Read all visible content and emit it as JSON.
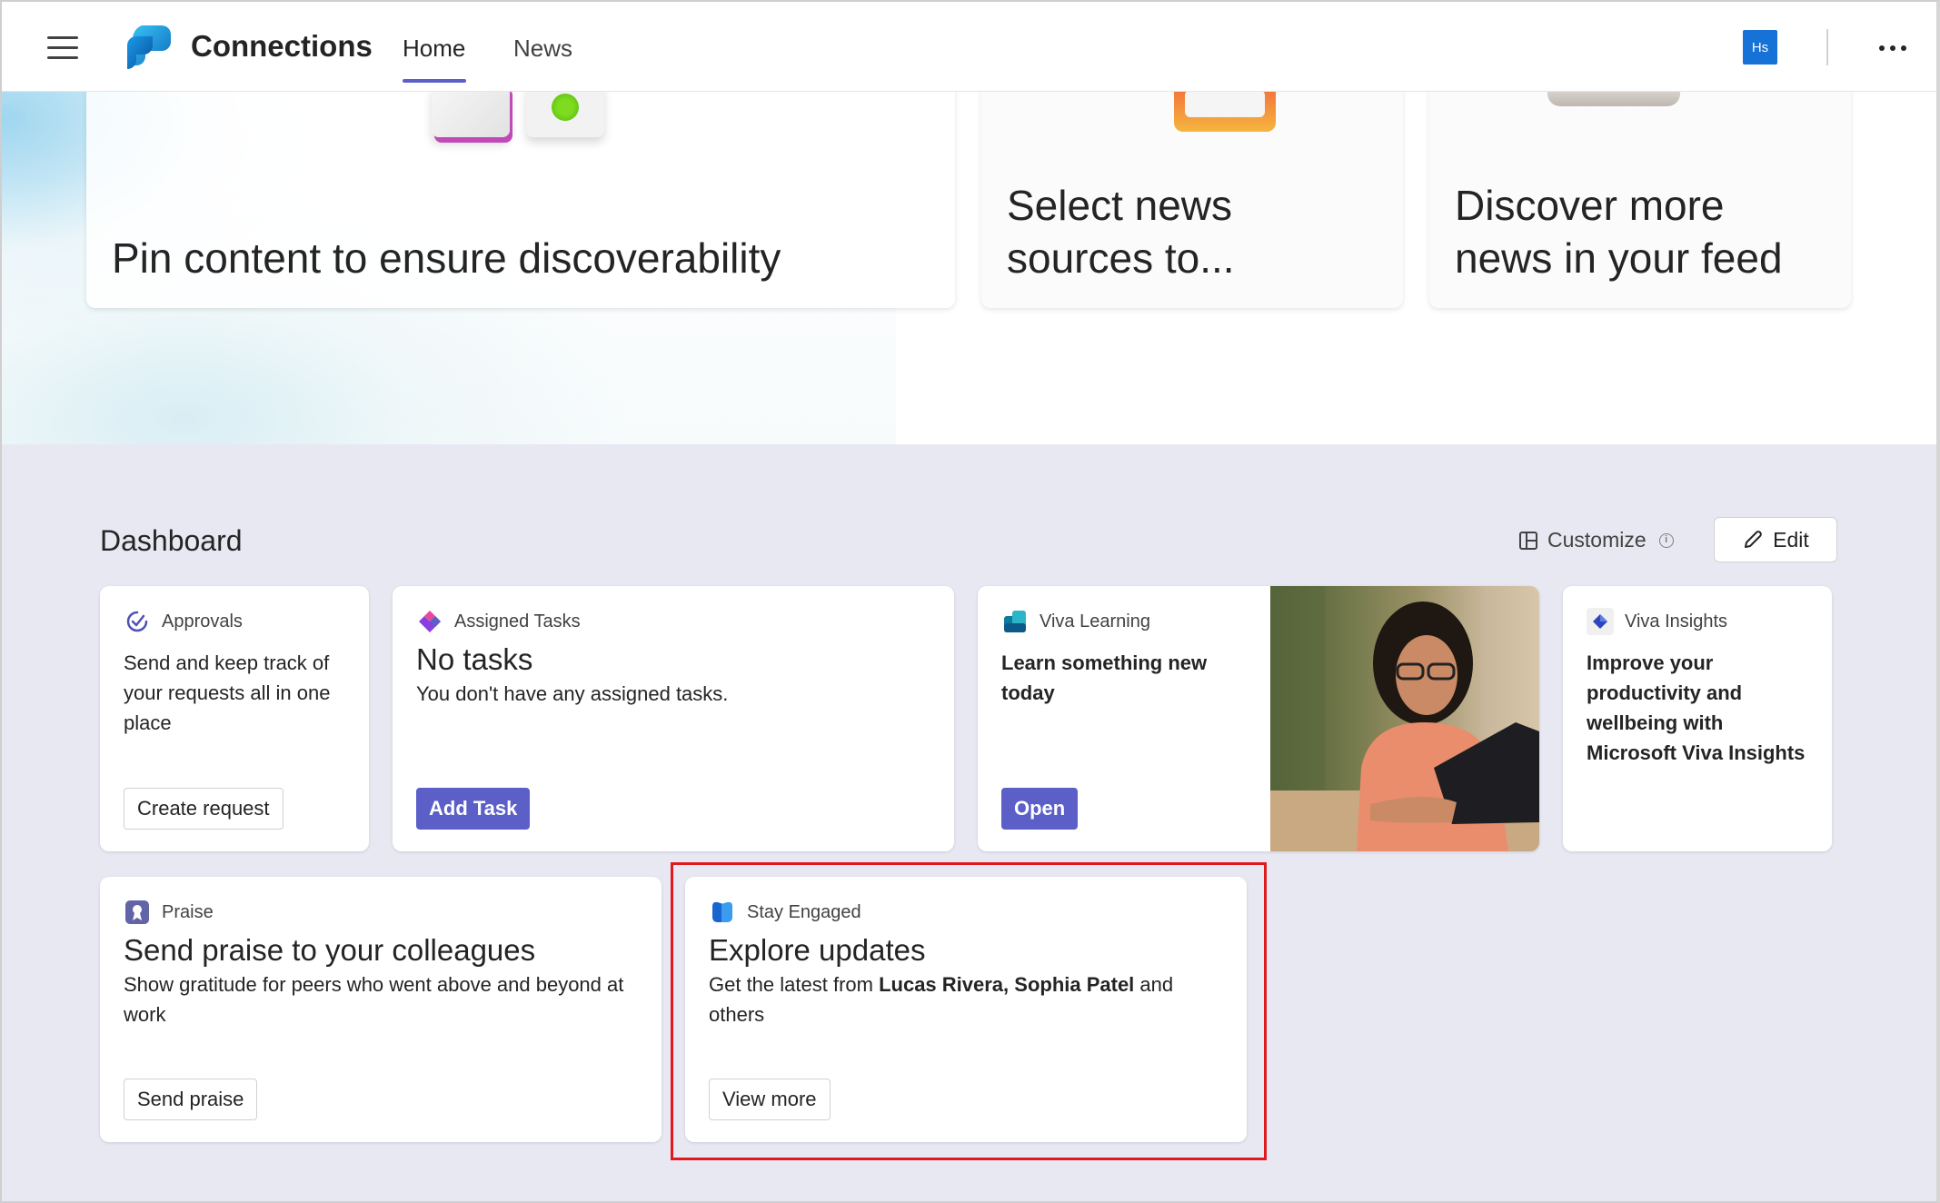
{
  "topbar": {
    "app_title": "Connections",
    "tabs": [
      {
        "label": "Home",
        "active": true
      },
      {
        "label": "News",
        "active": false
      }
    ],
    "avatar_initials": "Hs",
    "accent": "#5b5fc7"
  },
  "hero": {
    "cards": [
      {
        "title": "Pin content to ensure discoverability"
      },
      {
        "title_line1": "Select news",
        "title_line2": "sources to..."
      },
      {
        "title_line1": "Discover more",
        "title_line2": "news in your feed"
      }
    ]
  },
  "dashboard": {
    "title": "Dashboard",
    "customize_label": "Customize",
    "edit_label": "Edit",
    "cards": {
      "approvals": {
        "app": "Approvals",
        "text": "Send and keep track of your requests all in one place",
        "button": "Create request"
      },
      "tasks": {
        "app": "Assigned Tasks",
        "title": "No tasks",
        "text": "You don't have any assigned tasks.",
        "button": "Add Task"
      },
      "learning": {
        "app": "Viva Learning",
        "text": "Learn something new today",
        "button": "Open"
      },
      "insights": {
        "app": "Viva Insights",
        "text": "Improve your productivity and wellbeing with Microsoft Viva Insights"
      },
      "praise": {
        "app": "Praise",
        "title": "Send praise to your colleagues",
        "text": "Show gratitude for peers who went above and beyond at work",
        "button": "Send praise"
      },
      "engaged": {
        "app": "Stay Engaged",
        "title": "Explore updates",
        "text_prefix": "Get the latest from ",
        "names": "Lucas Rivera, Sophia Patel",
        "text_suffix": " and others",
        "button": "View more"
      }
    }
  }
}
